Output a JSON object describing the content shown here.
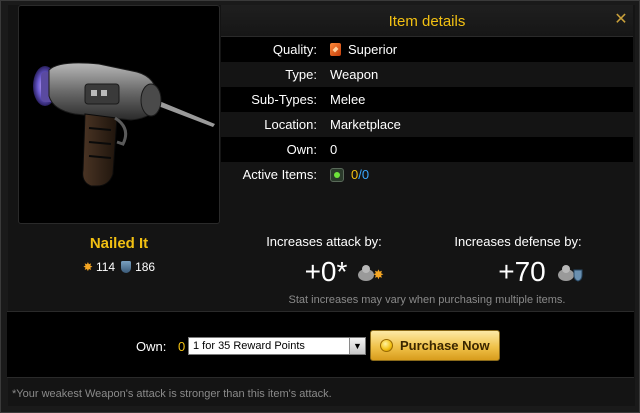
{
  "header": {
    "title": "Item details"
  },
  "details": [
    {
      "label": "Quality:",
      "value": "Superior"
    },
    {
      "label": "Type:",
      "value": "Weapon"
    },
    {
      "label": "Sub-Types:",
      "value": "Melee"
    },
    {
      "label": "Location:",
      "value": "Marketplace"
    },
    {
      "label": "Own:",
      "value": "0"
    }
  ],
  "active_items": {
    "label": "Active Items:",
    "current": "0",
    "separator": " / ",
    "max": "0"
  },
  "item": {
    "name": "Nailed It",
    "attack": "114",
    "defense": "186"
  },
  "increases": {
    "attack_label": "Increases attack by:",
    "attack_value": "+0*",
    "defense_label": "Increases defense by:",
    "defense_value": "+70",
    "note": "Stat increases may vary when purchasing multiple items."
  },
  "purchase": {
    "own_label": "Own:",
    "own_count": "0",
    "selected_option": "1 for 35 Reward Points",
    "button_label": "Purchase Now"
  },
  "footer_note": "*Your weakest Weapon's attack is stronger than this item's attack.",
  "colors": {
    "accent": "#f2c012",
    "link": "#3aa8ff",
    "button": "#f0c24a"
  },
  "icons": {
    "close": "close-icon",
    "quality": "quality-gem-icon",
    "active": "active-item-icon",
    "attack": "attack-icon",
    "defense": "defense-shield-icon",
    "coin": "coin-icon"
  }
}
